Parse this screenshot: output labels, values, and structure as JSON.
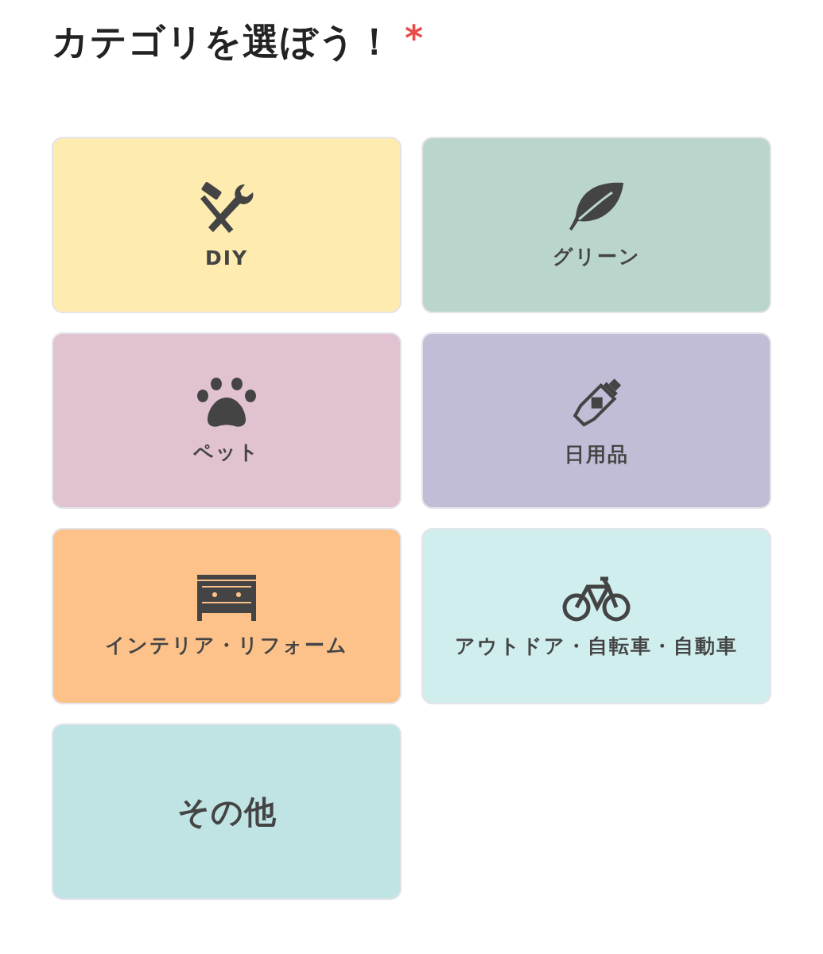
{
  "heading": {
    "title": "カテゴリを選ぼう！",
    "required_mark": "*"
  },
  "categories": [
    {
      "label": "DIY",
      "color": "#feebb0",
      "kind": "icon"
    },
    {
      "label": "グリーン",
      "color": "#bad6cc",
      "kind": "icon"
    },
    {
      "label": "ペット",
      "color": "#e0c2d0",
      "kind": "icon"
    },
    {
      "label": "日用品",
      "color": "#c2bdd6",
      "kind": "icon"
    },
    {
      "label": "インテリア・リフォーム",
      "color": "#fdc28a",
      "kind": "icon"
    },
    {
      "label": "アウトドア・自転車・自動車",
      "color": "#d1eeee",
      "kind": "icon"
    },
    {
      "label": "その他",
      "color": "#c0e3e4",
      "kind": "text"
    }
  ]
}
